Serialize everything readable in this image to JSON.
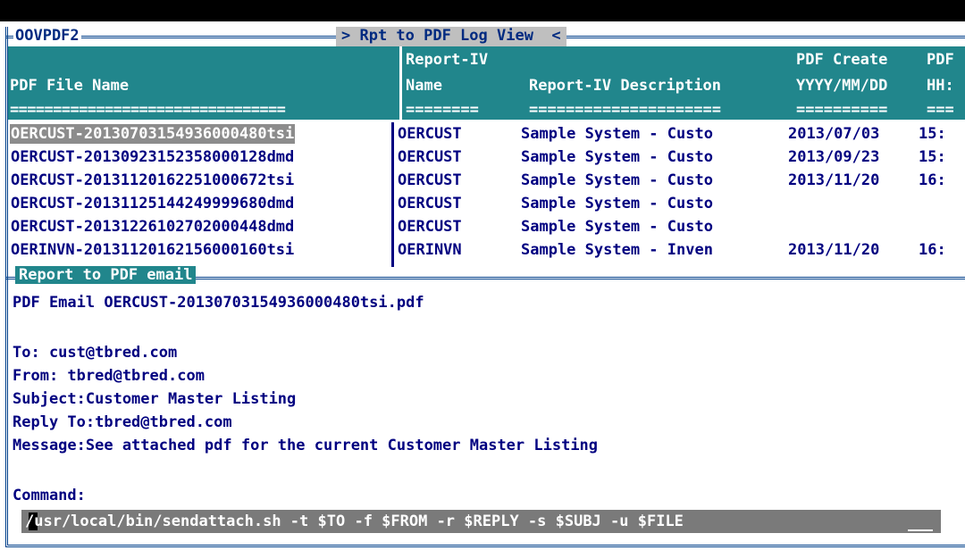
{
  "window": {
    "program_id": "OOVPDF2",
    "title": "> Rpt to PDF Log View  <"
  },
  "log_table": {
    "headers": {
      "file_name": "PDF File Name",
      "file_underline": "================================",
      "report_name_top": "Report-IV",
      "report_name_bottom": "Name",
      "report_name_underline": "========",
      "description": "Report-IV Description",
      "description_underline": "=====================",
      "create_top": "PDF Create",
      "create_bottom": "YYYY/MM/DD",
      "create_underline": "==========",
      "time_top": "PDF",
      "time_bottom": "HH:",
      "time_underline": "==="
    },
    "rows": [
      {
        "file": "OERCUST-20130703154936000480tsi",
        "name": "OERCUST",
        "desc": "Sample System - Custo",
        "date": "2013/07/03",
        "time": "15:"
      },
      {
        "file": "OERCUST-20130923152358000128dmd",
        "name": "OERCUST",
        "desc": "Sample System - Custo",
        "date": "2013/09/23",
        "time": "15:"
      },
      {
        "file": "OERCUST-20131120162251000672tsi",
        "name": "OERCUST",
        "desc": "Sample System - Custo",
        "date": "2013/11/20",
        "time": "16:"
      },
      {
        "file": "OERCUST-20131125144249999680dmd",
        "name": "OERCUST",
        "desc": "Sample System - Custo",
        "date": "",
        "time": ""
      },
      {
        "file": "OERCUST-20131226102702000448dmd",
        "name": "OERCUST",
        "desc": "Sample System - Custo",
        "date": "",
        "time": ""
      },
      {
        "file": "OERINVN-20131120162156000160tsi",
        "name": "OERINVN",
        "desc": "Sample System - Inven",
        "date": "2013/11/20",
        "time": "16:"
      }
    ]
  },
  "email_panel": {
    "title": "Report to PDF email",
    "heading": "PDF Email OERCUST-20130703154936000480tsi.pdf",
    "to": "To: cust@tbred.com",
    "from": "From: tbred@tbred.com",
    "subject": "Subject:Customer Master Listing",
    "reply_to": "Reply To:tbred@tbred.com",
    "message": "Message:See attached pdf for the current Customer Master Listing",
    "command_label": "Command:",
    "command_value": "/usr/local/bin/sendattach.sh -t $TO -f $FROM -r $REPLY -s $SUBJ -u $FILE"
  },
  "colors": {
    "header_bg": "#21868c",
    "text": "#000080",
    "selected_bg": "#8c8c8c",
    "title_bar": "#bfbfbf",
    "command_bg": "#7a7a7a"
  }
}
